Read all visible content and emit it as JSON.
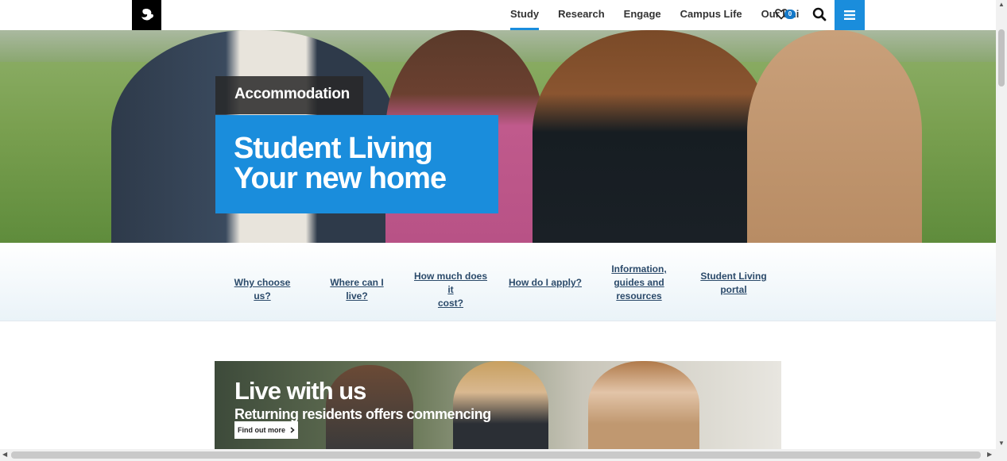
{
  "nav": {
    "items": [
      {
        "label": "Study",
        "active": true
      },
      {
        "label": "Research",
        "active": false
      },
      {
        "label": "Engage",
        "active": false
      },
      {
        "label": "Campus Life",
        "active": false
      },
      {
        "label": "Our Uni",
        "active": false
      }
    ],
    "favourites_count": "0",
    "accent_color": "#1a8ddc"
  },
  "hero": {
    "kicker": "Accommodation",
    "headline_line1": "Student Living",
    "headline_line2": "Your new home"
  },
  "quick_links": [
    {
      "line1": "Why choose us?",
      "line2": ""
    },
    {
      "line1": "Where can I live?",
      "line2": ""
    },
    {
      "line1": "How much does it",
      "line2": "cost?"
    },
    {
      "line1": "How do I apply?",
      "line2": ""
    },
    {
      "line1": "Information,",
      "line2": "guides and",
      "line3": "resources"
    },
    {
      "line1": "Student Living",
      "line2": "portal"
    }
  ],
  "promo": {
    "title": "Live with us",
    "subtitle": "Returning residents offers commencing",
    "button_label": "Find out more",
    "button_icon": "chevron-right-icon"
  },
  "icons": [
    "logo",
    "heart-icon",
    "search-icon",
    "hamburger-menu-icon"
  ]
}
